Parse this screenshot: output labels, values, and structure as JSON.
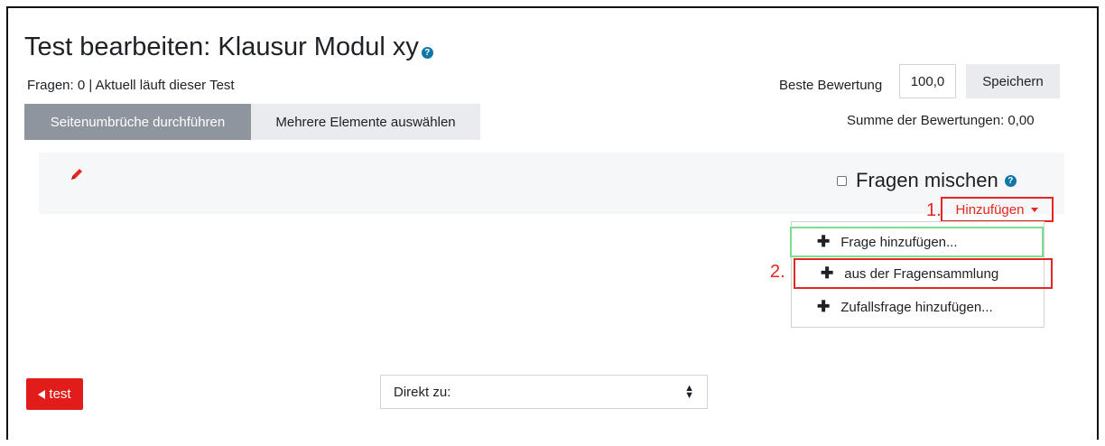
{
  "header": {
    "title": "Test bearbeiten: Klausur Modul xy",
    "help_icon": "question-circle-icon",
    "info": "Fragen: 0 | Aktuell läuft dieser Test"
  },
  "toolbar": {
    "repaginate_label": "Seitenumbrüche durchführen",
    "select_multiple_label": "Mehrere Elemente auswählen"
  },
  "grading": {
    "max_grade_label": "Beste Bewertung",
    "max_grade_value": "100,0",
    "save_label": "Speichern",
    "sum_label": "Summe der Bewertungen: 0,00"
  },
  "section": {
    "edit_icon": "pencil-icon",
    "shuffle_label": "Fragen mischen",
    "shuffle_checked": false,
    "add_label": "Hinzufügen",
    "step1": "1.",
    "step2": "2."
  },
  "add_menu": {
    "items": [
      {
        "label": "Frage hinzufügen...",
        "icon": "plus-icon"
      },
      {
        "label": "aus der Fragensammlung",
        "icon": "plus-icon"
      },
      {
        "label": "Zufallsfrage hinzufügen...",
        "icon": "plus-icon"
      }
    ]
  },
  "footer": {
    "back_label": "test",
    "jump_label": "Direkt zu:"
  },
  "colors": {
    "accent_red": "#e21b1b",
    "highlight_red": "#e52621",
    "highlight_green": "#7fdd8f",
    "gray_button": "#8f959e",
    "help_blue": "#1177a6"
  }
}
